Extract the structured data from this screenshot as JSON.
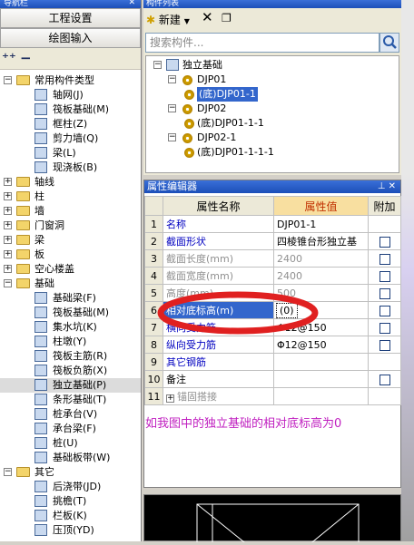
{
  "nav": {
    "title": "导航栏",
    "tabs": [
      "工程设置",
      "绘图输入"
    ],
    "tree": [
      {
        "label": "常用构件类型",
        "level": 0,
        "type": "folder",
        "expanded": true
      },
      {
        "label": "轴网(J)",
        "level": 1,
        "type": "item"
      },
      {
        "label": "筏板基础(M)",
        "level": 1,
        "type": "item"
      },
      {
        "label": "框柱(Z)",
        "level": 1,
        "type": "item"
      },
      {
        "label": "剪力墙(Q)",
        "level": 1,
        "type": "item"
      },
      {
        "label": "梁(L)",
        "level": 1,
        "type": "item"
      },
      {
        "label": "现浇板(B)",
        "level": 1,
        "type": "item"
      },
      {
        "label": "轴线",
        "level": 0,
        "type": "folder",
        "expanded": false
      },
      {
        "label": "柱",
        "level": 0,
        "type": "folder",
        "expanded": false
      },
      {
        "label": "墙",
        "level": 0,
        "type": "folder",
        "expanded": false
      },
      {
        "label": "门窗洞",
        "level": 0,
        "type": "folder",
        "expanded": false
      },
      {
        "label": "梁",
        "level": 0,
        "type": "folder",
        "expanded": false
      },
      {
        "label": "板",
        "level": 0,
        "type": "folder",
        "expanded": false
      },
      {
        "label": "空心楼盖",
        "level": 0,
        "type": "folder",
        "expanded": false
      },
      {
        "label": "基础",
        "level": 0,
        "type": "folder",
        "expanded": true
      },
      {
        "label": "基础梁(F)",
        "level": 1,
        "type": "item"
      },
      {
        "label": "筏板基础(M)",
        "level": 1,
        "type": "item"
      },
      {
        "label": "集水坑(K)",
        "level": 1,
        "type": "item"
      },
      {
        "label": "柱墩(Y)",
        "level": 1,
        "type": "item"
      },
      {
        "label": "筏板主筋(R)",
        "level": 1,
        "type": "item"
      },
      {
        "label": "筏板负筋(X)",
        "level": 1,
        "type": "item"
      },
      {
        "label": "独立基础(P)",
        "level": 1,
        "type": "item",
        "selected": true
      },
      {
        "label": "条形基础(T)",
        "level": 1,
        "type": "item"
      },
      {
        "label": "桩承台(V)",
        "level": 1,
        "type": "item"
      },
      {
        "label": "承台梁(F)",
        "level": 1,
        "type": "item"
      },
      {
        "label": "桩(U)",
        "level": 1,
        "type": "item"
      },
      {
        "label": "基础板带(W)",
        "level": 1,
        "type": "item"
      },
      {
        "label": "其它",
        "level": 0,
        "type": "folder",
        "expanded": true
      },
      {
        "label": "后浇带(JD)",
        "level": 1,
        "type": "item"
      },
      {
        "label": "挑檐(T)",
        "level": 1,
        "type": "item"
      },
      {
        "label": "栏板(K)",
        "level": 1,
        "type": "item"
      },
      {
        "label": "压顶(YD)",
        "level": 1,
        "type": "item"
      }
    ]
  },
  "list": {
    "title": "构件列表",
    "new_label": "新建",
    "search_placeholder": "搜索构件...",
    "tree": [
      {
        "label": "独立基础",
        "level": 0
      },
      {
        "label": "DJP01",
        "level": 1
      },
      {
        "label": "(底)DJP01-1",
        "level": 2,
        "selected": true
      },
      {
        "label": "DJP02",
        "level": 1
      },
      {
        "label": "(底)DJP01-1-1",
        "level": 2
      },
      {
        "label": "DJP02-1",
        "level": 1
      },
      {
        "label": "(底)DJP01-1-1-1",
        "level": 2
      }
    ]
  },
  "props": {
    "title": "属性编辑器",
    "headers": [
      "属性名称",
      "属性值",
      "附加"
    ],
    "rows": [
      {
        "num": "1",
        "name": "名称",
        "value": "DJP01-1",
        "style": "blue",
        "check": false
      },
      {
        "num": "2",
        "name": "截面形状",
        "value": "四棱锥台形独立基",
        "style": "blue",
        "check": true
      },
      {
        "num": "3",
        "name": "截面长度(mm)",
        "value": "2400",
        "style": "gray",
        "check": true
      },
      {
        "num": "4",
        "name": "截面宽度(mm)",
        "value": "2400",
        "style": "gray",
        "check": true
      },
      {
        "num": "5",
        "name": "高度(mm)",
        "value": "500",
        "style": "gray",
        "check": true
      },
      {
        "num": "6",
        "name": "相对底标高(m)",
        "value": "(0)",
        "style": "highlight",
        "check": true
      },
      {
        "num": "7",
        "name": "横向受力筋",
        "value": "Φ12@150",
        "style": "blue",
        "check": true
      },
      {
        "num": "8",
        "name": "纵向受力筋",
        "value": "Φ12@150",
        "style": "blue",
        "check": true
      },
      {
        "num": "9",
        "name": "其它钢筋",
        "value": "",
        "style": "blue",
        "check": false
      },
      {
        "num": "10",
        "name": "备注",
        "value": "",
        "style": "black",
        "check": true
      },
      {
        "num": "11",
        "name": "锚固搭接",
        "value": "",
        "style": "gray",
        "check": false,
        "expandable": true
      }
    ]
  },
  "comment": "如我图中的独立基础的相对底标高为0",
  "colors": {
    "title_bar": "#1c4fb8",
    "annotation_circle": "#e02020",
    "comment_text": "#c020c0"
  }
}
